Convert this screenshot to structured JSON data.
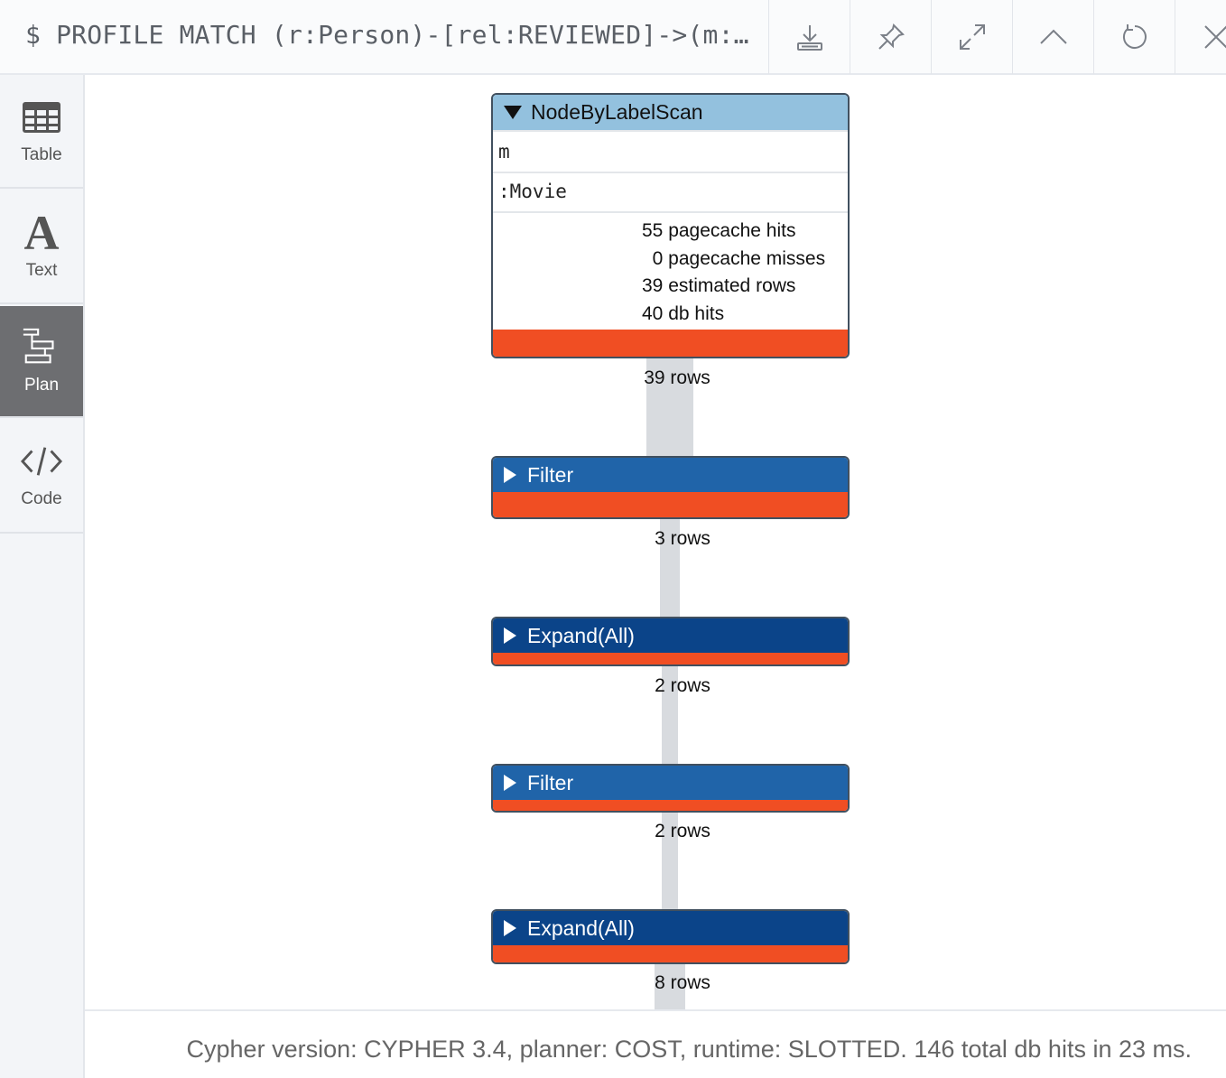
{
  "header": {
    "query": "$ PROFILE MATCH (r:Person)-[rel:REVIEWED]->(m:…",
    "buttons": [
      {
        "name": "download-icon"
      },
      {
        "name": "pin-icon"
      },
      {
        "name": "expand-icon"
      },
      {
        "name": "collapse-up-icon"
      },
      {
        "name": "rerun-icon"
      },
      {
        "name": "close-icon"
      }
    ]
  },
  "sidebar": {
    "items": [
      {
        "label": "Table",
        "icon": "table-icon"
      },
      {
        "label": "Text",
        "icon": "text-icon",
        "glyph": "A"
      },
      {
        "label": "Plan",
        "icon": "plan-icon",
        "active": true
      },
      {
        "label": "Code",
        "icon": "code-icon"
      }
    ]
  },
  "plan": {
    "operators": [
      {
        "name": "NodeByLabelScan",
        "expanded": true,
        "identifier": "m",
        "label": ":Movie",
        "stats": [
          "55 pagecache hits",
          "  0 pagecache misses",
          "39 estimated rows",
          "40 db hits"
        ],
        "rows": "39 rows"
      },
      {
        "name": "Filter",
        "expanded": false,
        "rows": "3 rows"
      },
      {
        "name": "Expand(All)",
        "expanded": false,
        "rows": "2 rows"
      },
      {
        "name": "Filter",
        "expanded": false,
        "rows": "2 rows"
      },
      {
        "name": "Expand(All)",
        "expanded": false,
        "rows": "8 rows"
      }
    ],
    "colors": {
      "scan_header": "#93c1de",
      "filter_header": "#2064a9",
      "expand_header": "#0b4489",
      "cost_bar": "#f04e23",
      "pipe": "#d8dbdf"
    }
  },
  "footer": {
    "summary": "Cypher version: CYPHER 3.4, planner: COST, runtime: SLOTTED. 146 total db hits in 23 ms."
  }
}
